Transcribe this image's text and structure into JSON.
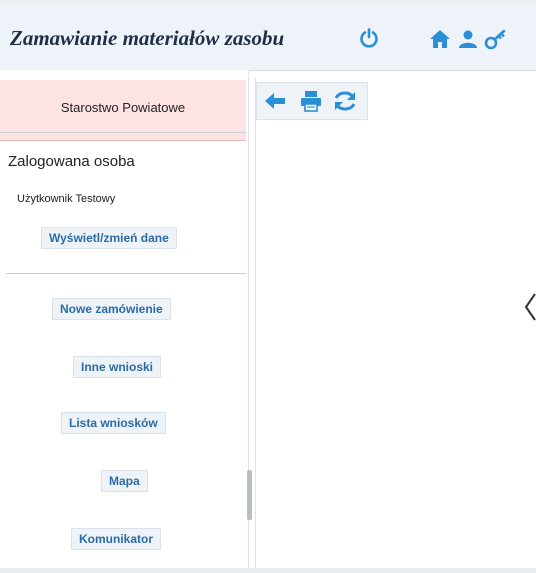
{
  "header": {
    "title": "Zamawianie materiałów zasobu",
    "icons": {
      "power": "power-icon",
      "home": "home-icon",
      "user": "user-icon",
      "key": "key-icon"
    }
  },
  "sidebar": {
    "organization": "Starostwo Powiatowe",
    "logged_in_heading": "Zalogowana osoba",
    "user_name": "Użytkownik Testowy",
    "edit_profile_label": "Wyświetl/zmień dane",
    "menu": [
      {
        "label": "Nowe zamówienie"
      },
      {
        "label": "Inne wnioski"
      },
      {
        "label": "Lista wniosków"
      },
      {
        "label": "Mapa"
      },
      {
        "label": "Komunikator"
      }
    ]
  },
  "toolbar": {
    "icons": [
      "back-arrow-icon",
      "print-icon",
      "refresh-icon"
    ]
  },
  "colors": {
    "accent": "#2b8fd6",
    "link": "#2b6ca8",
    "org_box": "#fde3e1",
    "header_bg": "#eef3f9"
  }
}
